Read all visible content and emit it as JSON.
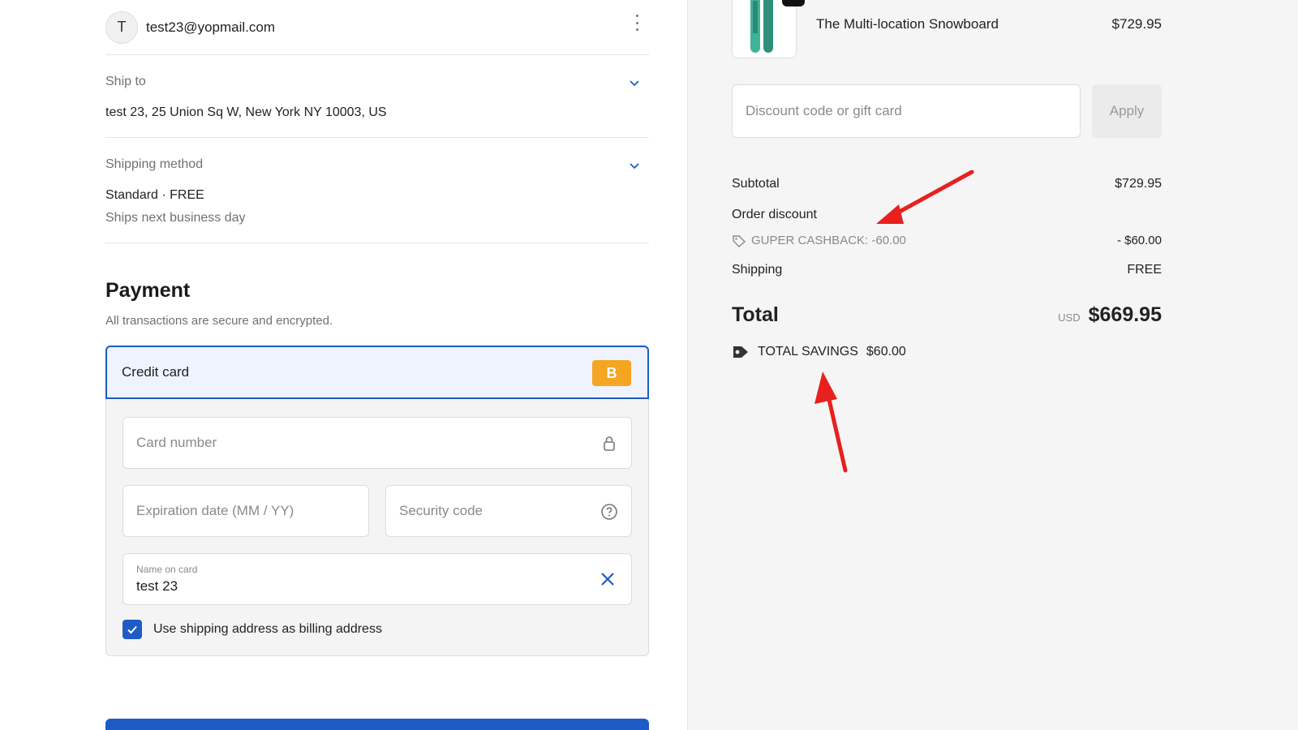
{
  "contact": {
    "avatar_initial": "T",
    "email": "test23@yopmail.com"
  },
  "ship_to": {
    "label": "Ship to",
    "value": "test 23, 25 Union Sq W, New York NY 10003, US"
  },
  "shipping_method": {
    "label": "Shipping method",
    "value": "Standard · FREE",
    "sub": "Ships next business day"
  },
  "payment": {
    "title": "Payment",
    "subtitle": "All transactions are secure and encrypted.",
    "method_label": "Credit card",
    "card_badge": "B",
    "card_number_placeholder": "Card number",
    "expiration_placeholder": "Expiration date (MM / YY)",
    "security_placeholder": "Security code",
    "name_label": "Name on card",
    "name_value": "test 23",
    "billing_checkbox_label": "Use shipping address as billing address",
    "billing_checked": true
  },
  "order": {
    "product_name": "The Multi-location Snowboard",
    "product_price": "$729.95",
    "discount_placeholder": "Discount code or gift card",
    "apply_label": "Apply",
    "subtotal_label": "Subtotal",
    "subtotal_value": "$729.95",
    "order_discount_label": "Order discount",
    "discount_code_label": "GUPER CASHBACK: -60.00",
    "discount_value": "- $60.00",
    "shipping_label": "Shipping",
    "shipping_value": "FREE",
    "total_label": "Total",
    "currency": "USD",
    "total_value": "$669.95",
    "savings_label": "TOTAL SAVINGS",
    "savings_value": "$60.00"
  },
  "colors": {
    "accent": "#1e5bc6",
    "badge": "#f4a521",
    "annotation_arrow": "#e8201e"
  }
}
